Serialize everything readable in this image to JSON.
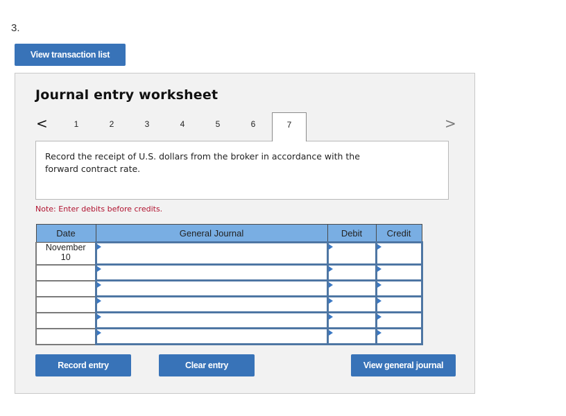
{
  "question_number": "3.",
  "view_transaction_list_label": "View transaction list",
  "worksheet": {
    "title": "Journal entry worksheet",
    "nav": {
      "prev_icon": "chevron-left-icon",
      "next_icon": "chevron-right-icon",
      "prev_glyph": "<",
      "next_glyph": ">",
      "tabs": [
        "1",
        "2",
        "3",
        "4",
        "5",
        "6",
        "7"
      ],
      "active_tab": "7"
    },
    "instruction": "Record the receipt of U.S. dollars from the broker in accordance with the forward contract rate.",
    "note": "Note: Enter debits before credits.",
    "table": {
      "headers": {
        "date": "Date",
        "general_journal": "General Journal",
        "debit": "Debit",
        "credit": "Credit"
      },
      "rows": [
        {
          "date_line1": "November",
          "date_line2": "10",
          "general_journal": "",
          "debit": "",
          "credit": ""
        },
        {
          "date_line1": "",
          "date_line2": "",
          "general_journal": "",
          "debit": "",
          "credit": ""
        },
        {
          "date_line1": "",
          "date_line2": "",
          "general_journal": "",
          "debit": "",
          "credit": ""
        },
        {
          "date_line1": "",
          "date_line2": "",
          "general_journal": "",
          "debit": "",
          "credit": ""
        },
        {
          "date_line1": "",
          "date_line2": "",
          "general_journal": "",
          "debit": "",
          "credit": ""
        },
        {
          "date_line1": "",
          "date_line2": "",
          "general_journal": "",
          "debit": "",
          "credit": ""
        }
      ]
    },
    "buttons": {
      "record_entry": "Record entry",
      "clear_entry": "Clear entry",
      "view_general_journal": "View general journal"
    }
  },
  "colors": {
    "button_blue": "#3873b8",
    "header_blue": "#79aee3",
    "cell_border": "#4e76a3",
    "note_red": "#b0122f",
    "panel_bg": "#f2f2f2"
  }
}
